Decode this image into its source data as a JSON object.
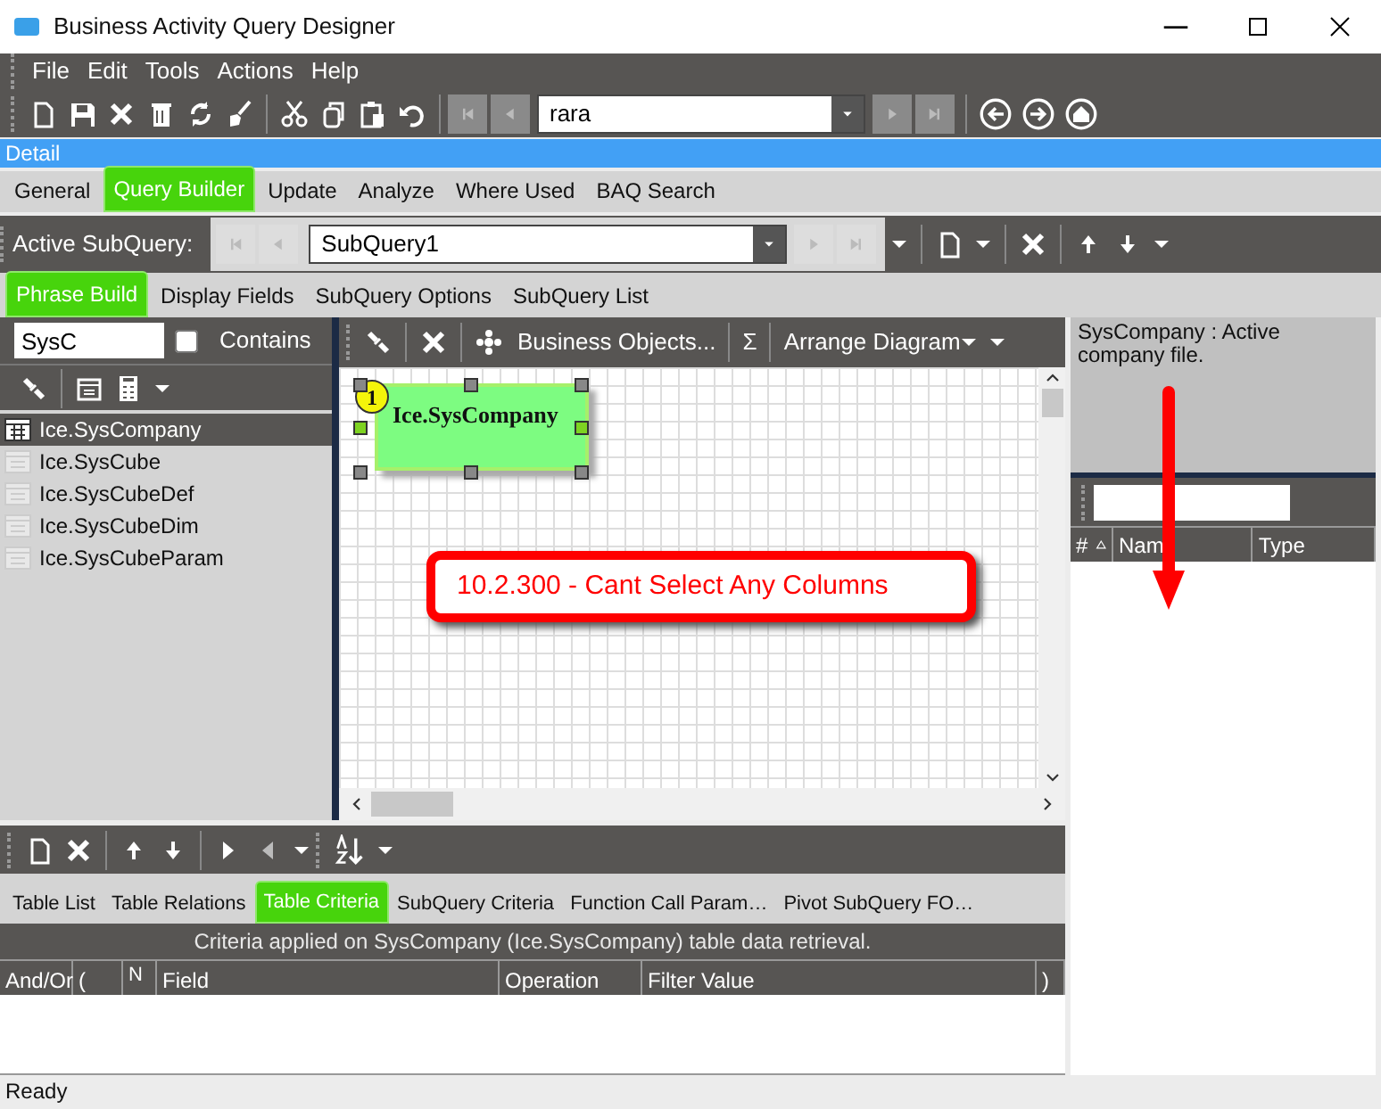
{
  "window": {
    "title": "Business Activity Query Designer"
  },
  "menu": [
    "File",
    "Edit",
    "Tools",
    "Actions",
    "Help"
  ],
  "record_nav": {
    "value": "rara"
  },
  "detail_bar": "Detail",
  "tabs": [
    {
      "label": "General",
      "selected": false
    },
    {
      "label": "Query Builder",
      "selected": true
    },
    {
      "label": "Update",
      "selected": false
    },
    {
      "label": "Analyze",
      "selected": false
    },
    {
      "label": "Where Used",
      "selected": false
    },
    {
      "label": "BAQ Search",
      "selected": false
    }
  ],
  "subquery_bar": {
    "label": "Active SubQuery:",
    "value": "SubQuery1"
  },
  "subtabs": [
    {
      "label": "Phrase Build",
      "selected": true
    },
    {
      "label": "Display Fields",
      "selected": false
    },
    {
      "label": "SubQuery Options",
      "selected": false
    },
    {
      "label": "SubQuery List",
      "selected": false
    }
  ],
  "table_search": {
    "value": "SysC",
    "contains_label": "Contains",
    "contains_checked": false
  },
  "tables": [
    {
      "name": "Ice.SysCompany",
      "selected": true
    },
    {
      "name": "Ice.SysCube",
      "selected": false
    },
    {
      "name": "Ice.SysCubeDef",
      "selected": false
    },
    {
      "name": "Ice.SysCubeDim",
      "selected": false
    },
    {
      "name": "Ice.SysCubeParam",
      "selected": false
    }
  ],
  "diagram_toolbar": {
    "business_objects": "Business Objects...",
    "sum": "Σ",
    "arrange": "Arrange Diagram"
  },
  "diagram": {
    "tables": [
      {
        "number": "1",
        "name": "Ice.SysCompany",
        "selected": true
      }
    ]
  },
  "annotation": {
    "text": "10.2.300 - Cant Select Any Columns"
  },
  "description": "SysCompany : Active company file.",
  "columns_grid": {
    "columns": [
      "#",
      "Nam",
      "Type"
    ]
  },
  "bottom_tabs": [
    {
      "label": "Table List",
      "selected": false
    },
    {
      "label": "Table Relations",
      "selected": false
    },
    {
      "label": "Table Criteria",
      "selected": true
    },
    {
      "label": "SubQuery Criteria",
      "selected": false
    },
    {
      "label": "Function Call Param…",
      "selected": false
    },
    {
      "label": "Pivot SubQuery FO…",
      "selected": false
    }
  ],
  "criteria": {
    "caption": "Criteria applied on SysCompany (Ice.SysCompany)  table data retrieval.",
    "columns": [
      "And/Or",
      "(",
      "N",
      "Field",
      "Operation",
      "Filter Value",
      ")"
    ]
  },
  "status_bar": "Ready"
}
